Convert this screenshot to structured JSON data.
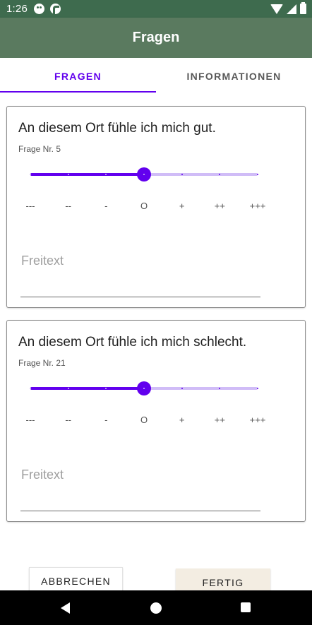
{
  "status_bar": {
    "time": "1:26"
  },
  "app_bar": {
    "title": "Fragen"
  },
  "tabs": [
    {
      "label": "FRAGEN",
      "selected": true
    },
    {
      "label": "INFORMATIONEN",
      "selected": false
    }
  ],
  "questions": [
    {
      "text": "An diesem Ort fühle ich mich gut.",
      "number": "Frage Nr. 5",
      "slider_value": 3,
      "freitext_placeholder": "Freitext",
      "freitext_value": ""
    },
    {
      "text": "An diesem Ort fühle ich mich schlecht.",
      "number": "Frage Nr. 21",
      "slider_value": 3,
      "freitext_placeholder": "Freitext",
      "freitext_value": ""
    }
  ],
  "scale_labels": [
    "---",
    "--",
    "-",
    "O",
    "+",
    "++",
    "+++"
  ],
  "slider_steps": 6,
  "buttons": {
    "cancel": "ABBRECHEN",
    "done": "FERTIG"
  },
  "colors": {
    "accent": "#6200ee",
    "accent_light": "#d0bcf7",
    "status_bar": "#3e6b4e",
    "app_bar": "#5a7a5f"
  },
  "icons": {
    "status": [
      "face-icon",
      "data-saver-icon",
      "wifi-icon",
      "signal-icon",
      "battery-icon"
    ],
    "nav": [
      "back-icon",
      "home-icon",
      "recents-icon"
    ]
  }
}
